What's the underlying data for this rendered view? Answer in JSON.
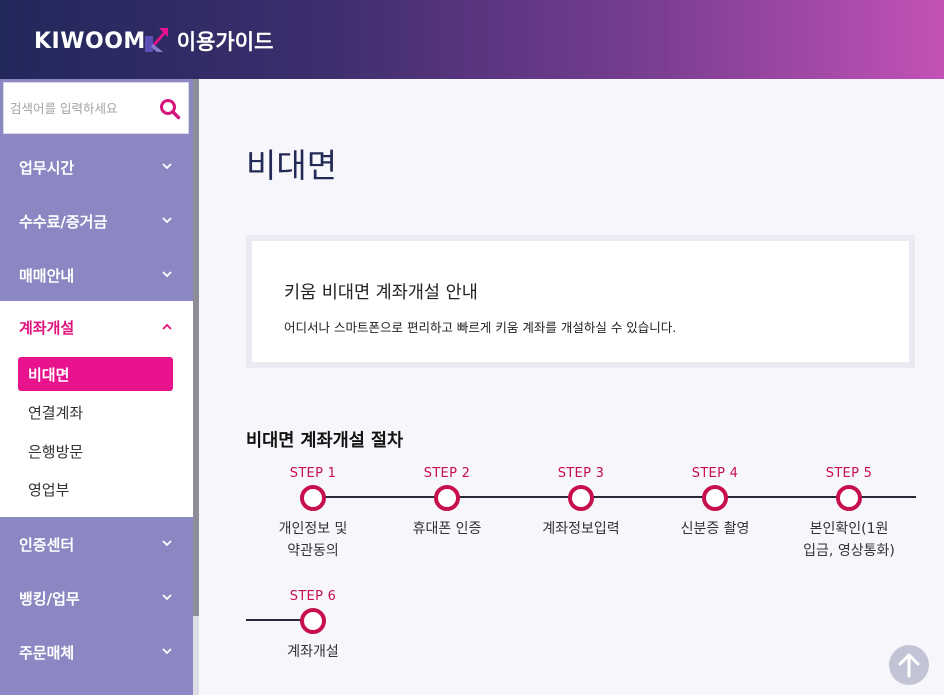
{
  "header": {
    "logo_text": "KIWOOM",
    "guide_title": "이용가이드",
    "gradient_colors": [
      "#21285a",
      "#3e2e6e",
      "#7b3e93",
      "#c352b5"
    ]
  },
  "sidebar": {
    "search_placeholder": "검색어를 입력하세요",
    "items_before": [
      {
        "label": "업무시간"
      },
      {
        "label": "수수료/증거금"
      },
      {
        "label": "매매안내"
      }
    ],
    "open_item": {
      "label": "계좌개설",
      "sub_items": [
        {
          "label": "비대면",
          "active": true
        },
        {
          "label": "연결계좌",
          "active": false
        },
        {
          "label": "은행방문",
          "active": false
        },
        {
          "label": "영업부",
          "active": false
        }
      ]
    },
    "items_after": [
      {
        "label": "인증센터"
      },
      {
        "label": "뱅킹/업무"
      },
      {
        "label": "주문매체"
      }
    ]
  },
  "main": {
    "page_title": "비대면",
    "info_box": {
      "title": "키움 비대면 계좌개설 안내",
      "description": "어디서나 스마트폰으로 편리하고 빠르게 키움 계좌를 개설하실 수 있습니다."
    },
    "procedure_title": "비대면 계좌개설 절차",
    "steps": [
      {
        "label": "STEP 1",
        "name_lines": [
          "개인정보 및",
          "약관동의"
        ]
      },
      {
        "label": "STEP 2",
        "name_lines": [
          "휴대폰 인증"
        ]
      },
      {
        "label": "STEP 3",
        "name_lines": [
          "계좌정보입력"
        ]
      },
      {
        "label": "STEP 4",
        "name_lines": [
          "신분증 촬영"
        ]
      },
      {
        "label": "STEP 5",
        "name_lines": [
          "본인확인(1원",
          "입금, 영상통화)"
        ]
      },
      {
        "label": "STEP 6",
        "name_lines": [
          "계좌개설"
        ]
      }
    ]
  },
  "colors": {
    "accent_pink": "#e7128c",
    "step_red": "#c70f4e",
    "sidebar_purple": "#8b87c3",
    "title_navy": "#222a55"
  }
}
